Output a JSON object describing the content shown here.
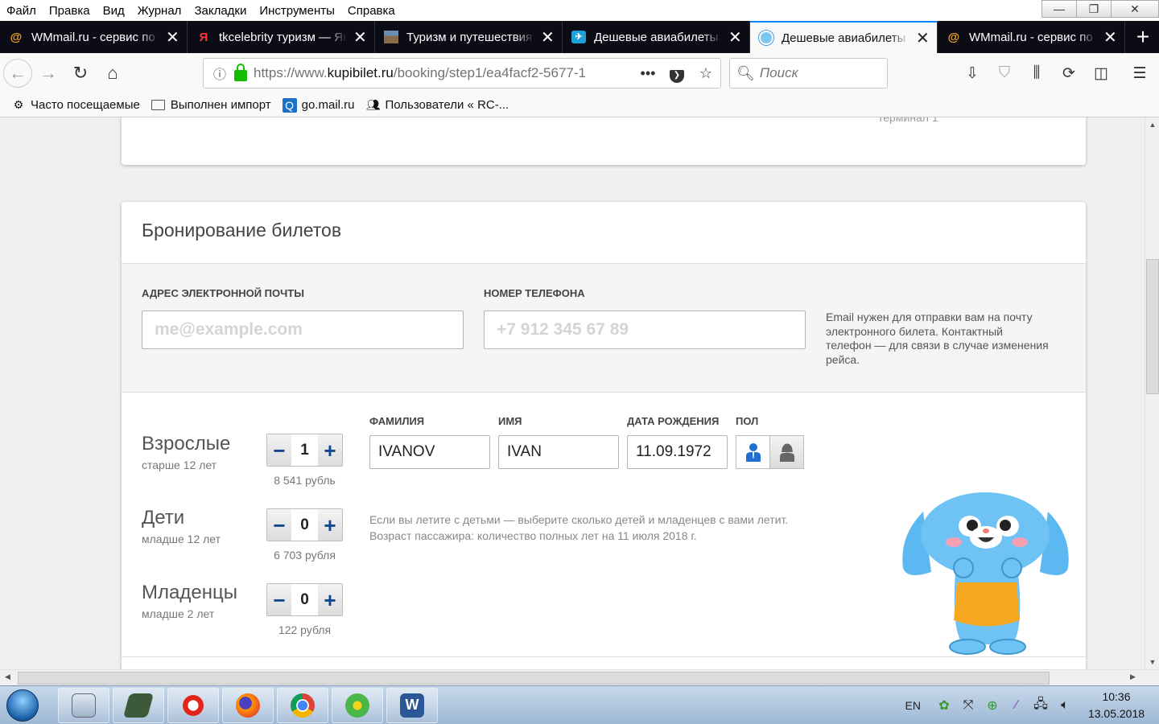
{
  "menu": [
    "Файл",
    "Правка",
    "Вид",
    "Журнал",
    "Закладки",
    "Инструменты",
    "Справка"
  ],
  "window_controls": {
    "minimize": "—",
    "maximize": "❐",
    "close": "✕"
  },
  "tabs": [
    {
      "title": "WMmail.ru - сервис по",
      "icon": "at-icon",
      "active": false
    },
    {
      "title": "tkcelebrity туризм — Ян",
      "icon": "yandex-icon",
      "active": false
    },
    {
      "title": "Туризм и путешествия",
      "icon": "travel-photo-icon",
      "active": false
    },
    {
      "title": "Дешевые авиабилеты",
      "icon": "plane-icon",
      "active": false
    },
    {
      "title": "Дешевые авиабилеты",
      "icon": "kupibilet-icon",
      "active": true
    },
    {
      "title": "WMmail.ru - сервис по",
      "icon": "at-icon",
      "active": false
    }
  ],
  "url": {
    "prefix": "https://www.",
    "domain": "kupibilet.ru",
    "path": "/booking/step1/ea4facf2-5677-1"
  },
  "search": {
    "placeholder": "Поиск"
  },
  "bookmarks": [
    {
      "label": "Часто посещаемые",
      "icon": "gear-icon"
    },
    {
      "label": "Выполнен импорт",
      "icon": "folder-icon"
    },
    {
      "label": "go.mail.ru",
      "icon": "search-icon"
    },
    {
      "label": "Пользователи « RC-...",
      "icon": "users-icon"
    }
  ],
  "prev_card": {
    "terminal_text": "терминал 1"
  },
  "booking": {
    "title": "Бронирование билетов",
    "email_label": "АДРЕС ЭЛЕКТРОННОЙ ПОЧТЫ",
    "email_placeholder": "me@example.com",
    "phone_label": "НОМЕР ТЕЛЕФОНА",
    "phone_placeholder": "+7 912 345 67 89",
    "contact_note": "Email нужен для отправки вам на почту электронного билета. Контактный телефон — для связи в случае изменения рейса.",
    "passenger_types": [
      {
        "name": "Взрослые",
        "sub": "старше 12 лет",
        "count": "1",
        "price": "8 541 рубль"
      },
      {
        "name": "Дети",
        "sub": "младше 12 лет",
        "count": "0",
        "price": "6 703 рубля"
      },
      {
        "name": "Младенцы",
        "sub": "младше 2 лет",
        "count": "0",
        "price": "122 рубля"
      }
    ],
    "stepper": {
      "minus": "−",
      "plus": "+"
    },
    "columns": {
      "surname": "ФАМИЛИЯ",
      "name": "ИМЯ",
      "birth": "ДАТА РОЖДЕНИЯ",
      "gender": "ПОЛ"
    },
    "passenger": {
      "surname": "IVANOV",
      "name": "IVAN",
      "birth": "11.09.1972"
    },
    "hint_line1": "Если вы летите с детьми — выберите сколько детей и младенцев с вами летит.",
    "hint_line2": "Возраст пассажира: количество полных лет на 11 июля 2018 г."
  },
  "taskbar": {
    "apps": [
      "calculator",
      "book",
      "ccleaner",
      "firefox",
      "chrome",
      "icq",
      "word"
    ],
    "lang": "EN",
    "time": "10:36",
    "date": "13.05.2018"
  },
  "colors": {
    "accent": "#0a84ff",
    "stepper_sign": "#11468f",
    "male_icon": "#1e6fd1",
    "mascot_blue": "#5bb8f0",
    "mascot_shirt": "#f6a821"
  }
}
